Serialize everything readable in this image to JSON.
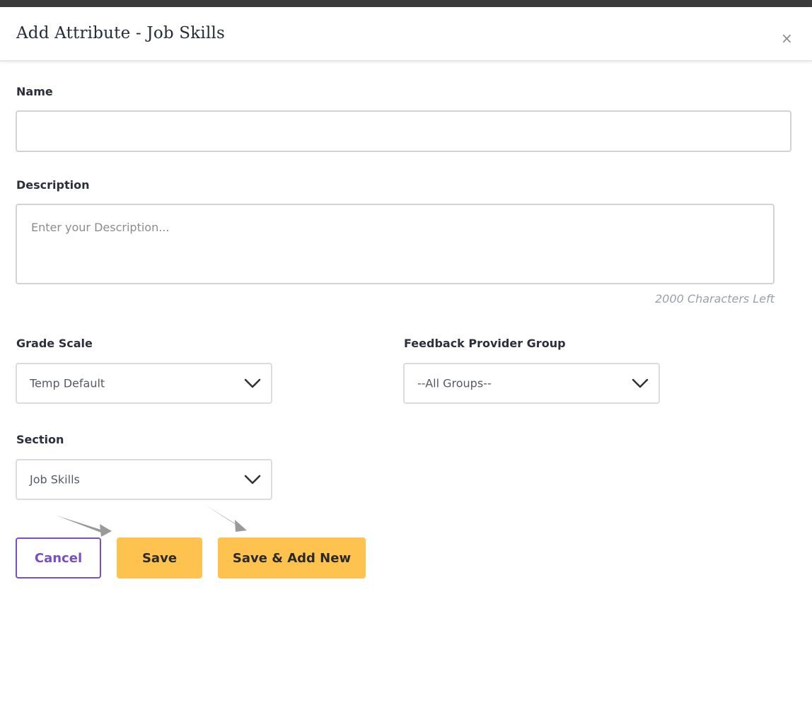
{
  "modal": {
    "title": "Add Attribute - Job Skills",
    "close_label": "×"
  },
  "form": {
    "name": {
      "label": "Name",
      "value": ""
    },
    "description": {
      "label": "Description",
      "value": "",
      "placeholder": "Enter your Description...",
      "chars_left": "2000 Characters Left"
    },
    "grade_scale": {
      "label": "Grade Scale",
      "selected": "Temp Default"
    },
    "feedback_provider_group": {
      "label": "Feedback Provider Group",
      "selected": "--All Groups--"
    },
    "section": {
      "label": "Section",
      "selected": "Job Skills"
    }
  },
  "actions": {
    "cancel_label": "Cancel",
    "save_label": "Save",
    "save_add_new_label": "Save & Add New"
  },
  "colors": {
    "primary_button": "#fec24f",
    "cancel_outline": "#7a4fc4",
    "annotation_arrow": "#9a9a9a"
  }
}
